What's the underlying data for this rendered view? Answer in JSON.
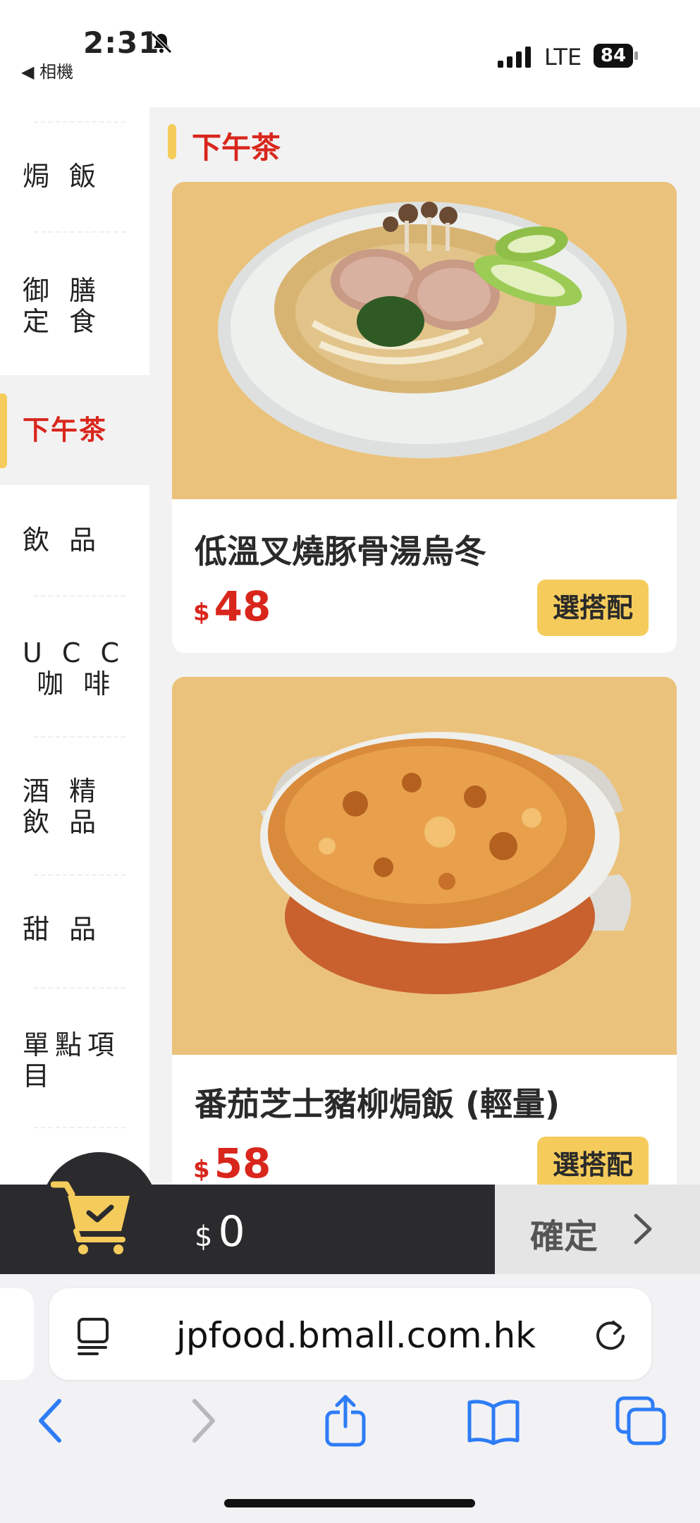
{
  "status_bar": {
    "time": "2:31",
    "back_app": "◀ 相機",
    "network": "LTE",
    "battery": "84"
  },
  "sidebar": {
    "items": [
      {
        "label": "焗 飯",
        "active": false
      },
      {
        "label": "御 膳\n定 食",
        "active": false
      },
      {
        "label": "下午茶",
        "active": true
      },
      {
        "label": "飲 品",
        "active": false
      },
      {
        "label": "U C C\n 咖 啡",
        "active": false
      },
      {
        "label": "酒 精\n飲 品",
        "active": false
      },
      {
        "label": "甜 品",
        "active": false
      },
      {
        "label": "單點項\n目",
        "active": false
      }
    ]
  },
  "section": {
    "title": "下午茶"
  },
  "products": [
    {
      "name": "低溫叉燒豚骨湯烏冬",
      "currency": "$",
      "price": "48",
      "option_label": "選搭配",
      "image": "udon-bowl-photo"
    },
    {
      "name": "番茄芝士豬柳焗飯 (輕量)",
      "currency": "$",
      "price": "58",
      "option_label": "選搭配",
      "image": "baked-rice-photo"
    }
  ],
  "cart": {
    "currency": "$",
    "total": "0",
    "confirm_label": "確定"
  },
  "browser": {
    "url": "jpfood.bmall.com.hk"
  },
  "colors": {
    "accent_red": "#d9261c",
    "accent_yellow": "#f5cc5c",
    "cart_bar": "#2b2b2d"
  }
}
